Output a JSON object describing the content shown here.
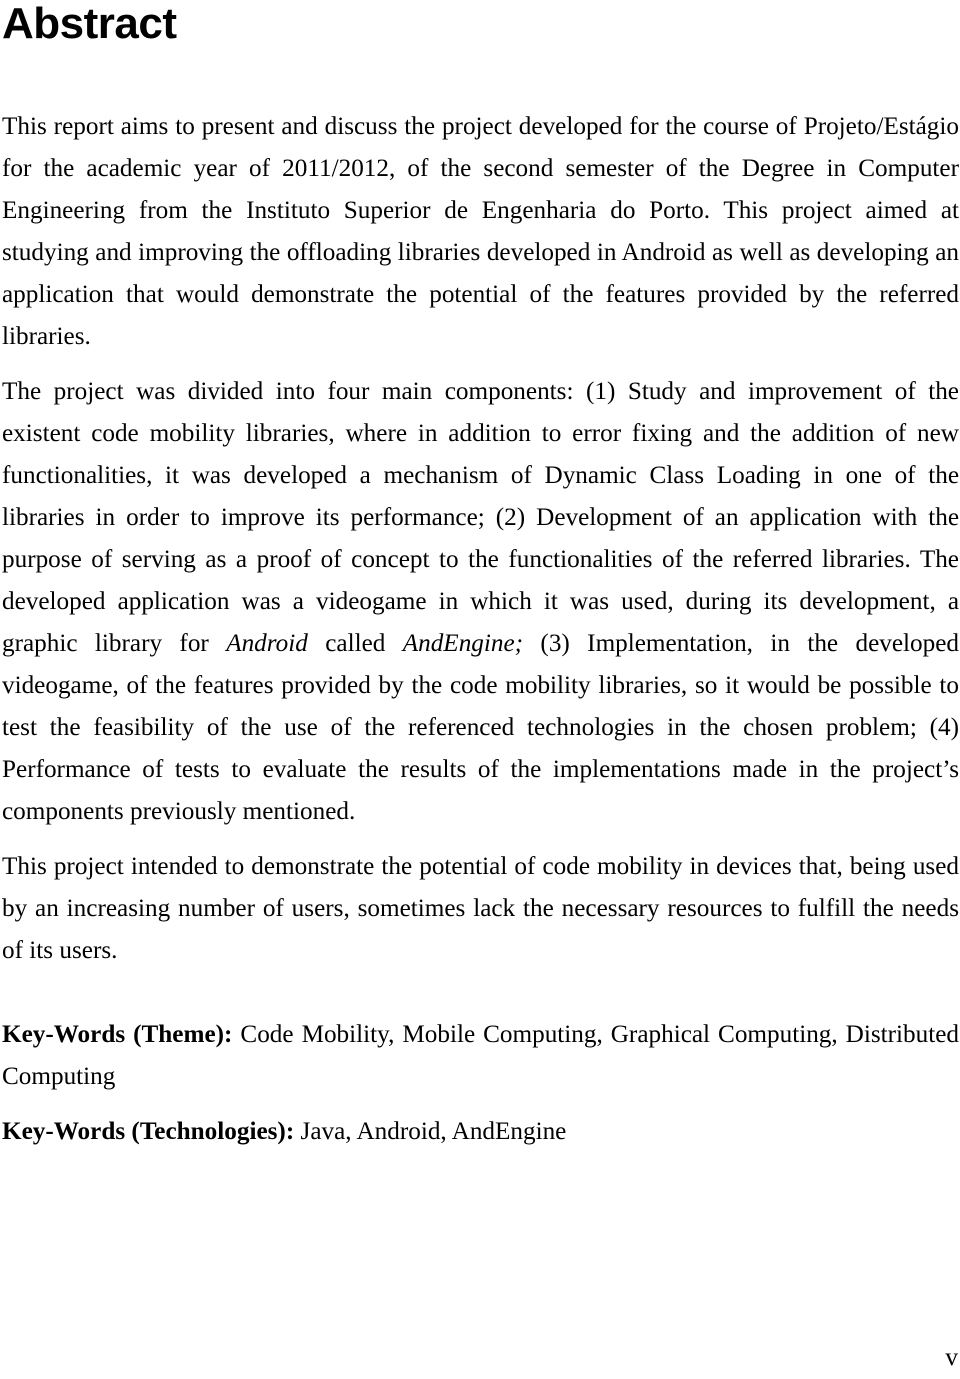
{
  "document": {
    "heading": "Abstract",
    "page_number": "v",
    "paragraphs": [
      {
        "id": "intro",
        "segments": [
          {
            "style": "normal",
            "text": "This report aims to present and discuss the project developed for the course of Projeto/Estágio for the academic year of 2011/2012, of the second semester of the Degree in Computer Engineering from the Instituto Superior de Engenharia do Porto. This project aimed at studying and improving the offloading libraries developed in Android as well as developing an application that would demonstrate the potential of the features provided by the referred libraries."
          }
        ]
      },
      {
        "id": "components",
        "segments": [
          {
            "style": "normal",
            "text": "The project was divided into four main components: (1) Study and improvement of the existent code mobility libraries, where in addition to error fixing and the addition of new functionalities, it was developed a mechanism of Dynamic Class Loading in one of the libraries in order to improve its performance; (2) Development of an application with the purpose of serving as a proof of concept to the functionalities of the referred libraries. The developed application was a videogame in which it was used, during its development, a graphic library for "
          },
          {
            "style": "italic",
            "text": "Android"
          },
          {
            "style": "normal",
            "text": " called "
          },
          {
            "style": "italic",
            "text": "AndEngine;"
          },
          {
            "style": "normal",
            "text": " (3) Implementation, in the developed videogame, of the features provided by the code mobility libraries, so it would be possible to test the feasibility of the use of the referenced technologies in the chosen problem; (4) Performance of tests to evaluate the results of the implementations made in the project’s components previously mentioned."
          }
        ]
      },
      {
        "id": "conclusion",
        "segments": [
          {
            "style": "normal",
            "text": "This project intended to demonstrate the potential of code mobility in devices that, being used by an increasing number of users, sometimes lack the necessary resources to fulfill the needs of its users."
          }
        ]
      }
    ],
    "keywords": [
      {
        "id": "theme",
        "label": "Key-Words (Theme):",
        "value": " Code Mobility, Mobile Computing, Graphical Computing, Distributed Computing"
      },
      {
        "id": "technologies",
        "label": "Key-Words (Technologies):",
        "value": " Java, Android, AndEngine"
      }
    ]
  }
}
